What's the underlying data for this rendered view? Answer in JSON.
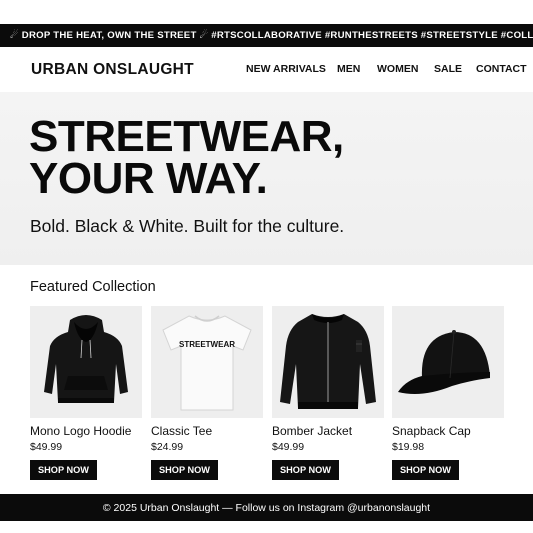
{
  "ticker": {
    "text": "☄ DROP THE HEAT, OWN THE STREET ☄ #RTSCOLLABORATIVE #RUNTHESTREETS  #STREETSTYLE #COLLABORATE ☄"
  },
  "header": {
    "logo": "URBAN ONSLAUGHT",
    "nav": [
      "NEW ARRIVALS",
      "MEN",
      "WOMEN",
      "SALE",
      "CONTACT"
    ]
  },
  "hero": {
    "title_line1": "STREETWEAR,",
    "title_line2": "YOUR WAY.",
    "subtitle": "Bold. Black & White. Built for the culture."
  },
  "featured": {
    "title": "Featured Collection",
    "products": [
      {
        "name": "Mono Logo Hoodie",
        "price": "$49.99",
        "button": "SHOP NOW",
        "icon": "hoodie-image"
      },
      {
        "name": "Classic Tee",
        "price": "$24.99",
        "button": "SHOP NOW",
        "icon": "tee-image",
        "print": "STREETWEAR"
      },
      {
        "name": "Bomber Jacket",
        "price": "$49.99",
        "button": "SHOP NOW",
        "icon": "bomber-jacket-image"
      },
      {
        "name": "Snapback Cap",
        "price": "$19.98",
        "button": "SHOP NOW",
        "icon": "cap-image"
      }
    ]
  },
  "footer": {
    "text": "© 2025 Urban Onslaught — Follow us on Instagram @urbanonslaught"
  },
  "colors": {
    "ink": "#0b0b0b",
    "paper": "#ffffff",
    "hero_bg": "#f2f2f2",
    "product_bg": "#eeeeee"
  }
}
